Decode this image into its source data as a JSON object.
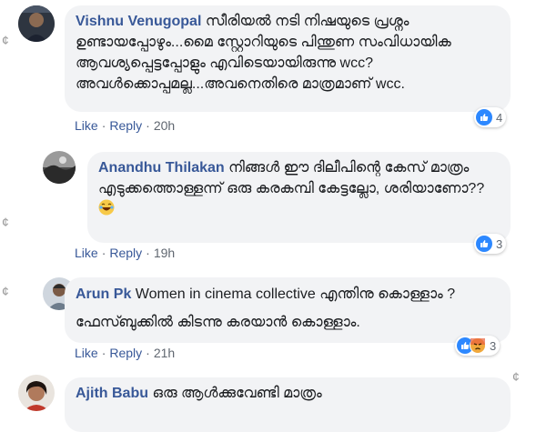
{
  "comments": [
    {
      "author": "Vishnu Venugopal",
      "text": "സീരിയൽ നടി നിഷയുടെ പ്രശ്നം ഉണ്ടായപ്പോഴും...മൈ സ്റ്റോറിയുടെ പിന്തുണ സംവിധായിക ആവശ്യപ്പെട്ടപ്പോളും എവിടെയായിരുന്നു wcc? അവൾക്കൊപ്പമല്ല...അവനെതിരെ മാത്രമാണ് wcc.",
      "like": "Like",
      "reply": "Reply",
      "time": "20h",
      "reaction_count": "4"
    },
    {
      "author": "Anandhu Thilakan",
      "text": "നിങ്ങൾ ഈ ദിലീപിന്റെ കേസ് മാത്രം എടുക്കത്തൊള്ളന്ന് ഒരു കരകമ്പി കേട്ടല്ലോ, ശരിയാണോ??",
      "like": "Like",
      "reply": "Reply",
      "time": "19h",
      "reaction_count": "3"
    },
    {
      "author": "Arun Pk",
      "text": "Women in cinema collective എന്തിനു കൊള്ളാം ?",
      "text2": "ഫേസ്ബുക്കിൽ കിടന്നു കരയാൻ കൊള്ളാം.",
      "like": "Like",
      "reply": "Reply",
      "time": "21h",
      "reaction_count": "3"
    },
    {
      "author": "Ajith Babu",
      "text": "ഒരു ആൾക്കുവേണ്ടി മാത്രം"
    }
  ],
  "colors": {
    "author_link": "#385898",
    "bubble_bg": "#f2f3f5",
    "like_blue": "#2d88ff",
    "meta_gray": "#606770"
  },
  "icons": {
    "like": "thumbs-up-icon",
    "angry": "angry-face-icon",
    "laugh": "laughing-emoji-icon"
  }
}
